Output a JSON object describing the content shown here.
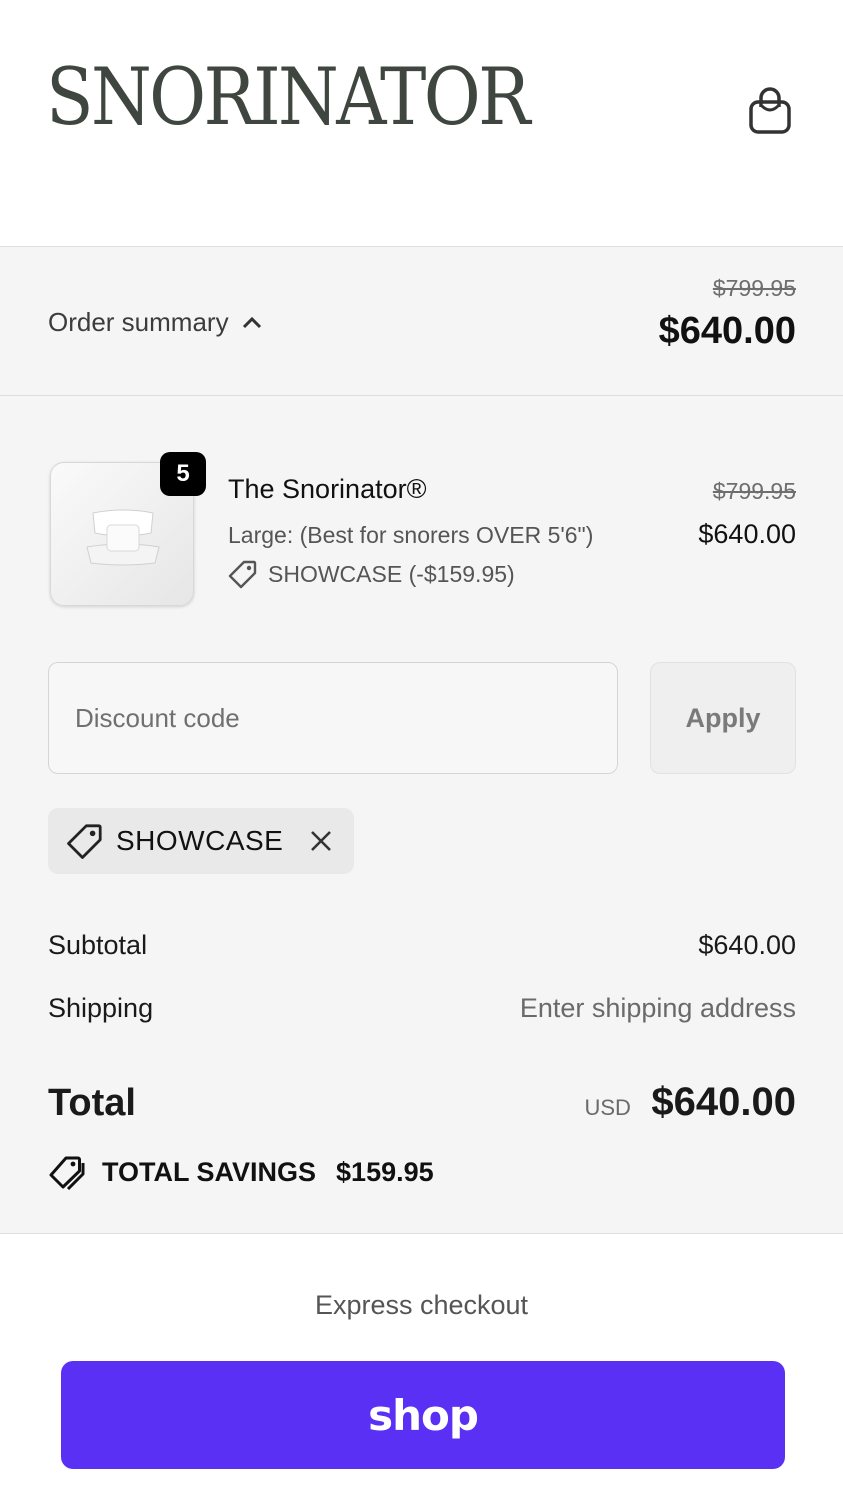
{
  "header": {
    "logo": "SNORINATOR",
    "cart_icon": "shopping-bag-icon"
  },
  "summary": {
    "toggle_label": "Order summary",
    "toggle_icon": "chevron-up-icon",
    "original_price": "$799.95",
    "total_price": "$640.00"
  },
  "item": {
    "quantity": "5",
    "title": "The Snorinator®",
    "variant": "Large: (Best for snorers OVER 5'6\")",
    "discount": "SHOWCASE (-$159.95)",
    "original_price": "$799.95",
    "price": "$640.00"
  },
  "discount": {
    "placeholder": "Discount code",
    "value": "",
    "apply_label": "Apply",
    "applied_code": "SHOWCASE"
  },
  "totals": {
    "subtotal_label": "Subtotal",
    "subtotal_value": "$640.00",
    "shipping_label": "Shipping",
    "shipping_value": "Enter shipping address",
    "total_label": "Total",
    "currency": "USD",
    "total_value": "$640.00",
    "savings_label": "TOTAL SAVINGS",
    "savings_value": "$159.95"
  },
  "express": {
    "label": "Express checkout",
    "shop_label": "shop"
  },
  "colors": {
    "shop_button": "#5a31f4",
    "logo": "#3f4640",
    "panel_bg": "#f5f5f5"
  }
}
